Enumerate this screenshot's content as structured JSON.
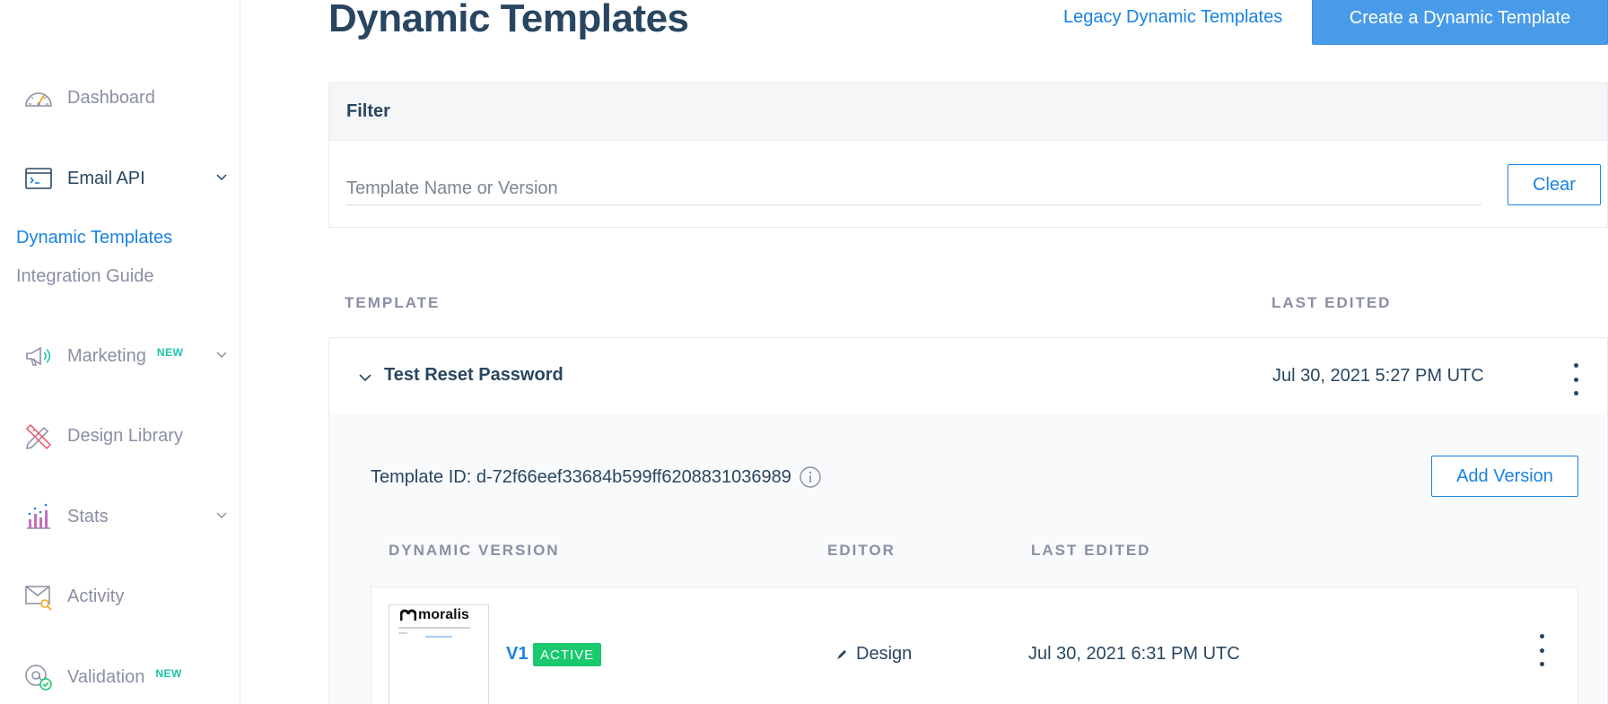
{
  "sidebar": {
    "items": [
      {
        "label": "Dashboard",
        "icon": "dashboard-gauge-icon"
      },
      {
        "label": "Email API",
        "icon": "terminal-window-icon",
        "expanded": true
      },
      {
        "label": "Marketing",
        "icon": "megaphone-icon",
        "badge": "NEW"
      },
      {
        "label": "Design Library",
        "icon": "pencil-ruler-icon"
      },
      {
        "label": "Stats",
        "icon": "bar-chart-icon"
      },
      {
        "label": "Activity",
        "icon": "envelope-search-icon"
      },
      {
        "label": "Validation",
        "icon": "at-check-icon",
        "badge": "NEW"
      }
    ],
    "email_api_sub": [
      {
        "label": "Dynamic Templates",
        "current": true
      },
      {
        "label": "Integration Guide",
        "current": false
      }
    ]
  },
  "header": {
    "title": "Dynamic Templates",
    "legacy_link": "Legacy Dynamic Templates",
    "create_button": "Create a Dynamic Template"
  },
  "filter": {
    "title": "Filter",
    "placeholder": "Template Name or Version",
    "value": "",
    "clear_button": "Clear"
  },
  "table": {
    "columns": [
      "TEMPLATE",
      "LAST EDITED"
    ],
    "rows": [
      {
        "name": "Test Reset Password",
        "last_edited": "Jul 30, 2021 5:27 PM UTC",
        "expanded": true,
        "template_id": "Template ID: d-72f66eef33684b599ff6208831036989",
        "add_version_button": "Add Version",
        "version_columns": [
          "DYNAMIC VERSION",
          "EDITOR",
          "LAST EDITED"
        ],
        "versions": [
          {
            "name": "V1",
            "status": "ACTIVE",
            "editor": "Design",
            "last_edited": "Jul 30, 2021 6:31 PM UTC",
            "thumbnail_logo": "moralis"
          }
        ]
      }
    ]
  },
  "colors": {
    "primary": "#1a82e2",
    "button_fill": "#489be8",
    "heading": "#294661",
    "muted": "#8b8fa3",
    "new_badge": "#1cc4a8",
    "active_badge": "#18c96e"
  }
}
